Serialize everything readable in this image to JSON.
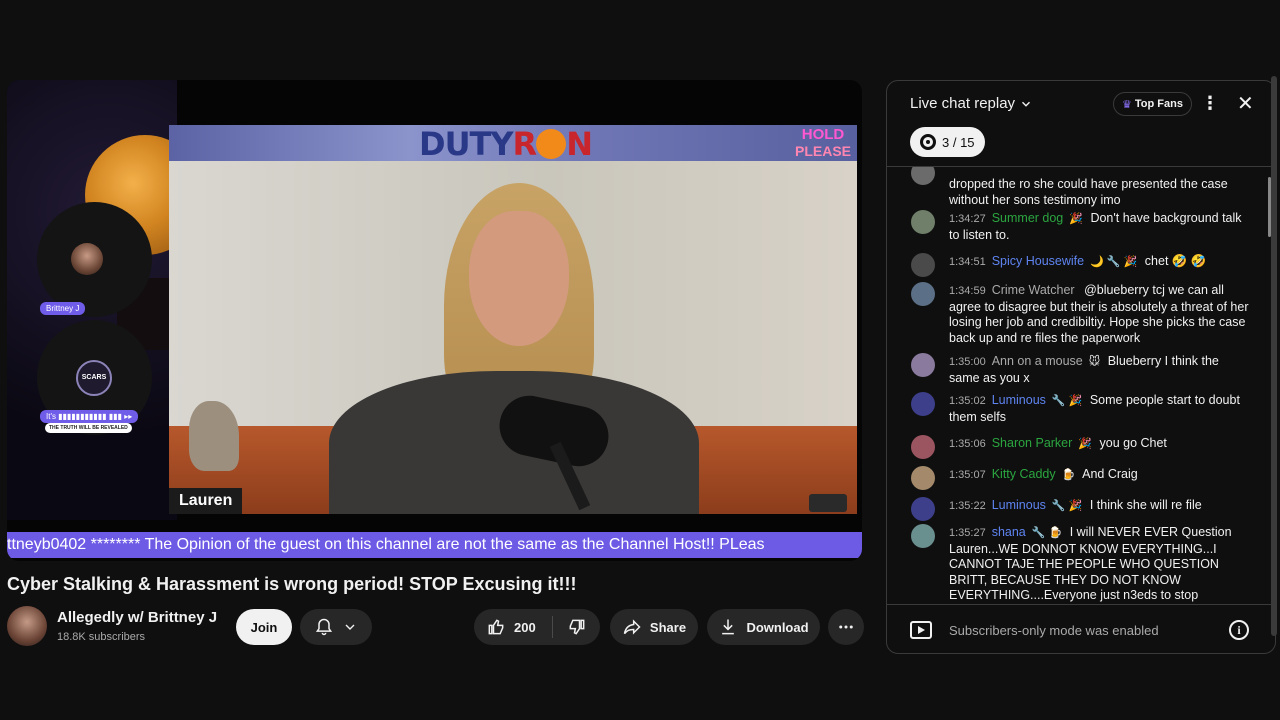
{
  "video": {
    "guest_label": "Brittney J",
    "its_label": "It's ▮▮▮▮▮▮▮▮▮▮▮ ▮▮▮ ▸▸",
    "truth_label": "THE TRUTH WILL BE REVEALED",
    "scars_label": "SCARS",
    "brand_left": "DUTY",
    "brand_right": "R",
    "brand_right2": "N",
    "hold_line1": "HOLD",
    "hold_line2": "PLEASE",
    "speaker_name": "Lauren",
    "ticker_text": "ttneyb0402 ******** The Opinion of the guest on this channel are not the same as the Channel Host!! PLeas"
  },
  "title": "Cyber Stalking & Harassment is wrong period! STOP Excusing it!!!",
  "channel": {
    "name": "Allegedly w/ Brittney J",
    "subscribers": "18.8K subscribers",
    "join_label": "Join"
  },
  "actions": {
    "likes": "200",
    "share_label": "Share",
    "download_label": "Download"
  },
  "chat": {
    "title": "Live chat replay",
    "top_fans_label": "Top Fans",
    "poll_count": "3 / 15",
    "footer_text": "Subscribers-only mode was enabled",
    "messages": [
      {
        "time": "",
        "author": "",
        "author_color": "#aaaaaa",
        "badges": "",
        "text": "dropped the ro she could have presented the case without her sons testimony imo",
        "avatar_color": "#6b6b6b"
      },
      {
        "time": "1:34:27",
        "author": "Summer dog",
        "author_color": "#2ba640",
        "badges": "🎉",
        "text": "Don't have background talk to listen to.",
        "avatar_color": "#6f7f6a"
      },
      {
        "time": "1:34:51",
        "author": "Spicy Housewife",
        "author_color": "#5e84f1",
        "badges": "🌙 🔧 🎉",
        "text": "chet 🤣 🤣",
        "avatar_color": "#4a4a4a"
      },
      {
        "time": "1:34:59",
        "author": "Crime Watcher",
        "author_color": "#aaaaaa",
        "badges": "",
        "text": "@blueberry tcj we can all agree to disagree but their is absolutely a threat of her losing her job and credibiltiy. Hope she picks the case back up and re files the paperwork",
        "avatar_color": "#5b6f86"
      },
      {
        "time": "1:35:00",
        "author": "Ann on a mouse",
        "author_color": "#aaaaaa",
        "badges": "🐭",
        "text": "Blueberry I think the same as you x",
        "avatar_color": "#8a7a9e"
      },
      {
        "time": "1:35:02",
        "author": "Luminous",
        "author_color": "#5e84f1",
        "badges": "🔧 🎉",
        "text": "Some people start to doubt them selfs",
        "avatar_color": "#3d3f8a"
      },
      {
        "time": "1:35:06",
        "author": "Sharon Parker",
        "author_color": "#2ba640",
        "badges": "🎉",
        "text": "you go Chet",
        "avatar_color": "#9b5560"
      },
      {
        "time": "1:35:07",
        "author": "Kitty Caddy",
        "author_color": "#2ba640",
        "badges": "🍺",
        "text": "And Craig",
        "avatar_color": "#a48a6a"
      },
      {
        "time": "1:35:22",
        "author": "Luminous",
        "author_color": "#5e84f1",
        "badges": "🔧 🎉",
        "text": "I think she will re file",
        "avatar_color": "#3d3f8a"
      },
      {
        "time": "1:35:27",
        "author": "shana",
        "author_color": "#5e84f1",
        "badges": "🔧 🍺",
        "text": "I will NEVER EVER Question Lauren...WE DONNOT KNOW EVERYTHING...I CANNOT TAJE THE PEOPLE WHO QUESTION BRITT, BECAUSE THEY DO NOT KNOW EVERYTHING....Everyone just n3eds to stop",
        "avatar_color": "#6a8f8f"
      }
    ]
  }
}
